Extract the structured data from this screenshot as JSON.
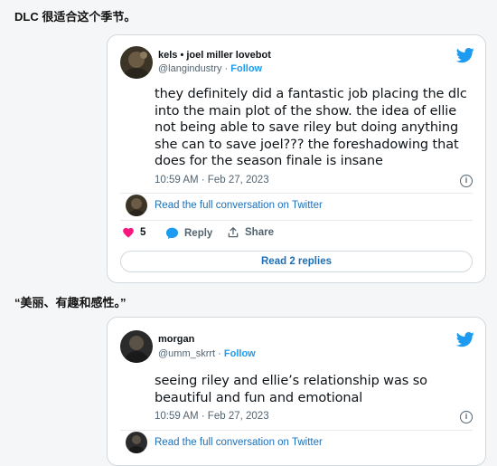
{
  "section1": {
    "heading": "DLC 很适合这个季节。"
  },
  "tweet1": {
    "name": "kels • joel miller lovebot",
    "handle": "@langindustry",
    "separator": " · ",
    "follow": "Follow",
    "text": "they definitely did a fantastic job placing the dlc into the main plot of the show. the idea of ellie not being able to save riley but doing anything she can to save joel??? the foreshadowing that does for the season finale is insane",
    "timestamp": "10:59 AM · Feb 27, 2023",
    "read_conversation": "Read the full conversation on Twitter",
    "likes": "5",
    "reply_label": "Reply",
    "share_label": "Share",
    "read_replies": "Read 2 replies"
  },
  "section2": {
    "heading": "“美丽、有趣和感性。”"
  },
  "tweet2": {
    "name": "morgan",
    "handle": "@umm_skrrt",
    "separator": " · ",
    "follow": "Follow",
    "text": "seeing riley and ellie’s relationship was so beautiful and fun and emotional",
    "timestamp": "10:59 AM · Feb 27, 2023",
    "read_conversation": "Read the full conversation on Twitter"
  },
  "colors": {
    "accent": "#1d9bf0",
    "link": "#1d6fb8",
    "like": "#f91880",
    "muted": "#536471"
  },
  "icons": {
    "brand": "twitter-bird-icon",
    "info": "info-icon",
    "like": "heart-icon",
    "reply": "speech-bubble-icon",
    "share": "share-upload-icon"
  }
}
